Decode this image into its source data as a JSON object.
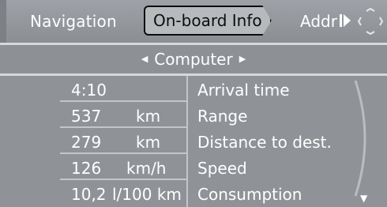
{
  "tabs": {
    "navigation": "Navigation",
    "onboard_info": "On-board Info",
    "address": "Addr"
  },
  "header": {
    "title": "Computer"
  },
  "rows": [
    {
      "value": "4:10",
      "unit": "",
      "label": "Arrival time"
    },
    {
      "value": "537",
      "unit": "km",
      "label": "Range"
    },
    {
      "value": "279",
      "unit": "km",
      "label": "Distance to dest."
    },
    {
      "value": "126",
      "unit": "km/h",
      "label": "Speed"
    },
    {
      "value": "10,2",
      "unit": "l/100 km",
      "label": "Consumption"
    }
  ],
  "icons": {
    "tab_right": "play-pause-icon",
    "controller": "joystick-icon",
    "prev": "arrow-left-icon",
    "next": "arrow-right-icon",
    "scroll": "arrow-down-icon"
  },
  "colors": {
    "background": "#8f9398",
    "selected_tab_bg": "#b7babd",
    "text": "#ffffff",
    "selected_text": "#0d0d0d"
  }
}
